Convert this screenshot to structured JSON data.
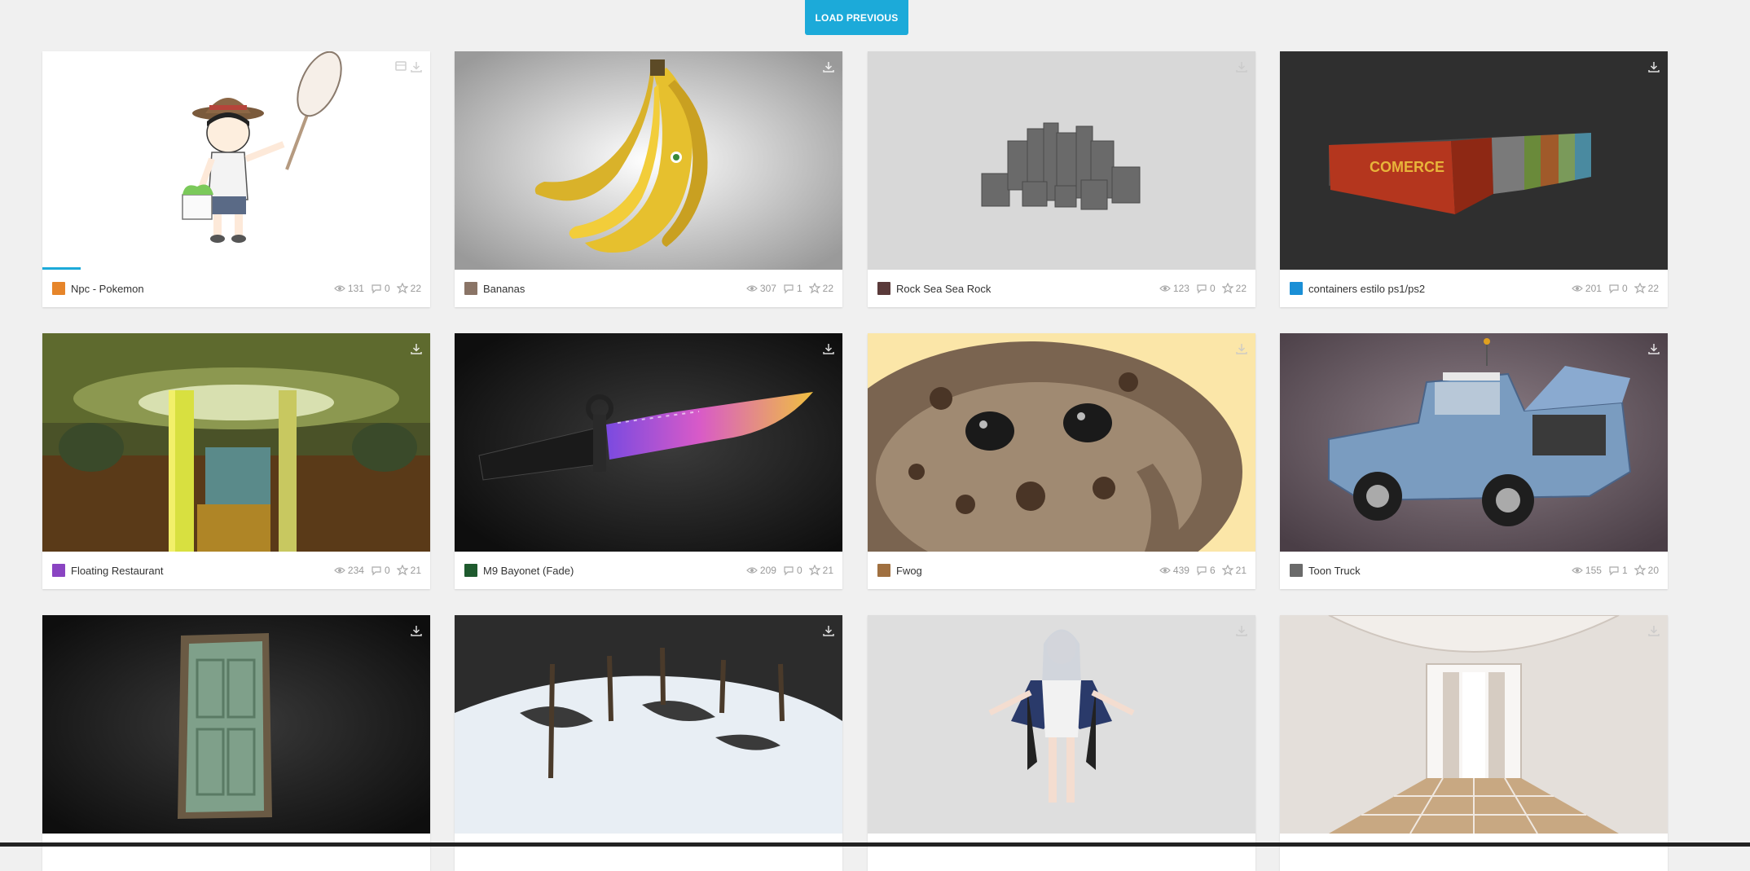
{
  "load_previous_label": "LOAD PREVIOUS",
  "accent_color": "#1caad9",
  "cards": [
    {
      "title": "Npc - Pokemon",
      "views": "131",
      "comments": "0",
      "likes": "22"
    },
    {
      "title": "Bananas",
      "views": "307",
      "comments": "1",
      "likes": "22"
    },
    {
      "title": "Rock Sea Sea Rock",
      "views": "123",
      "comments": "0",
      "likes": "22"
    },
    {
      "title": "containers estilo ps1/ps2",
      "views": "201",
      "comments": "0",
      "likes": "22"
    },
    {
      "title": "Floating Restaurant",
      "views": "234",
      "comments": "0",
      "likes": "21"
    },
    {
      "title": "M9 Bayonet (Fade)",
      "views": "209",
      "comments": "0",
      "likes": "21"
    },
    {
      "title": "Fwog",
      "views": "439",
      "comments": "6",
      "likes": "21"
    },
    {
      "title": "Toon Truck",
      "views": "155",
      "comments": "1",
      "likes": "20"
    },
    {
      "title": "",
      "views": "",
      "comments": "",
      "likes": ""
    },
    {
      "title": "",
      "views": "",
      "comments": "",
      "likes": ""
    },
    {
      "title": "",
      "views": "",
      "comments": "",
      "likes": ""
    },
    {
      "title": "",
      "views": "",
      "comments": "",
      "likes": ""
    }
  ]
}
